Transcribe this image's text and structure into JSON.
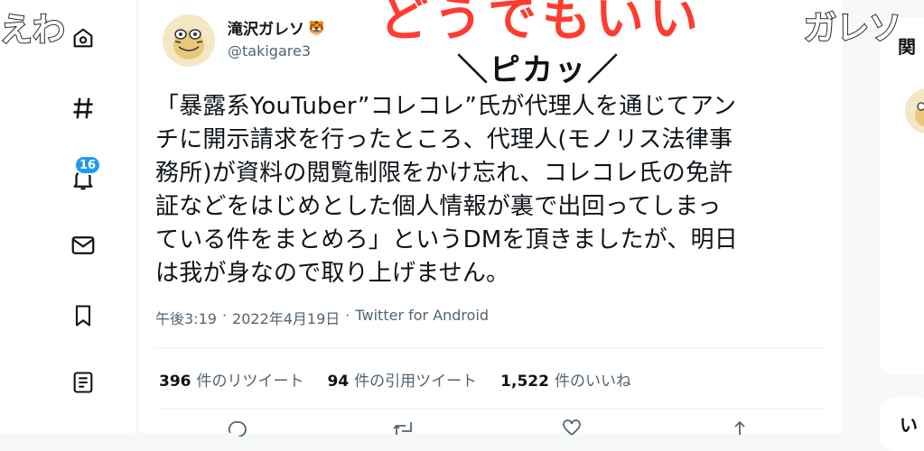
{
  "overlay": {
    "left_caption": "えわ",
    "top_caption": "どうでもいい",
    "right_caption": "ガレソ",
    "sfx": "＼ピカッ／"
  },
  "nav": {
    "items": [
      {
        "icon": "gear-icon"
      },
      {
        "icon": "hashtag-icon"
      },
      {
        "icon": "bell-icon"
      },
      {
        "icon": "mail-icon"
      },
      {
        "icon": "bookmark-icon"
      },
      {
        "icon": "list-icon"
      }
    ],
    "notification_count": "16"
  },
  "tweet": {
    "author_name": "滝沢ガレソ",
    "author_emoji": "🐯",
    "handle": "@takigare3",
    "text": "「暴露系YouTuber”コレコレ”氏が代理人を通じてアン\nチに開示請求を行ったところ、代理人(モノリス法律事\n務所)が資料の閲覧制限をかけ忘れ、コレコレ氏の免許\n証などをはじめとした個人情報が裏で出回ってしまっ\nている件をまとめろ」というDMを頂きましたが、明日\nは我が身なので取り上げません。",
    "time": "午後3:19",
    "date": "2022年4月19日",
    "separator": "·",
    "source": "Twitter for Android",
    "stats": {
      "retweets_count": "396",
      "retweets_label": "件のリツイート",
      "quotes_count": "94",
      "quotes_label": "件の引用ツイート",
      "likes_count": "1,522",
      "likes_label": "件のいいね"
    }
  },
  "right_sidebar": {
    "title_1": "関",
    "title_2": "い"
  },
  "colors": {
    "accent": "#1d9bf0",
    "overlay_red": "#ff3b2f"
  }
}
